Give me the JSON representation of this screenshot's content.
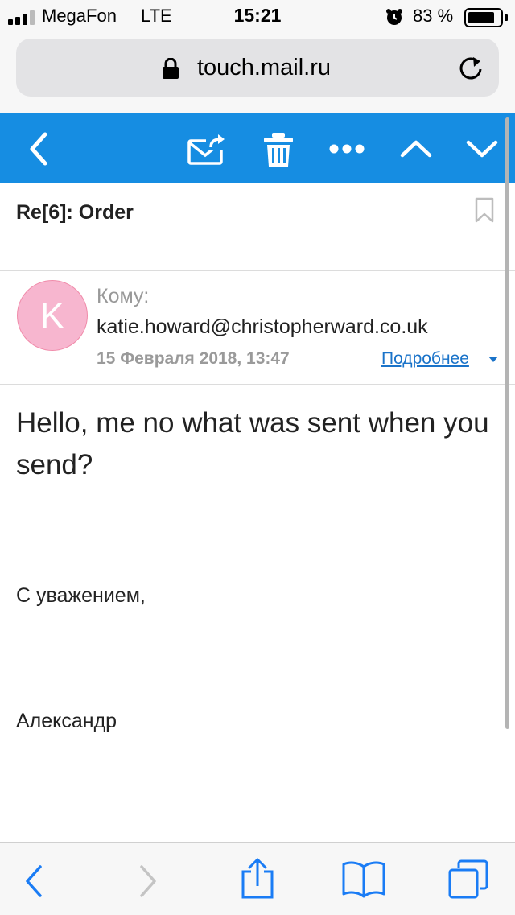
{
  "status_bar": {
    "carrier": "MegaFon",
    "network": "LTE",
    "time": "15:21",
    "battery_percent": "83 %"
  },
  "browser": {
    "url": "touch.mail.ru"
  },
  "message": {
    "subject": "Re[6]: Order",
    "avatar_letter": "K",
    "to_label": "Кому:",
    "to_address": "katie.howard@christopherward.co.uk",
    "date": "15 Февраля 2018, 13:47",
    "details_link": "Подробнее",
    "body": "Hello, me no what was sent when you send?",
    "signature_greeting": "С уважением,",
    "signature_name": "Александр"
  },
  "colors": {
    "toolbar": "#168de2",
    "link": "#1a73c9",
    "avatar": "#f7b6cf",
    "browser_blue": "#1a7cf5"
  },
  "icons": {
    "mail_toolbar": [
      "back-icon",
      "forward-mail-icon",
      "trash-icon",
      "more-icon",
      "prev-message-icon",
      "next-message-icon"
    ],
    "browser_toolbar": [
      "browser-back-icon",
      "browser-forward-icon",
      "share-icon",
      "bookmarks-icon",
      "tabs-icon"
    ]
  }
}
